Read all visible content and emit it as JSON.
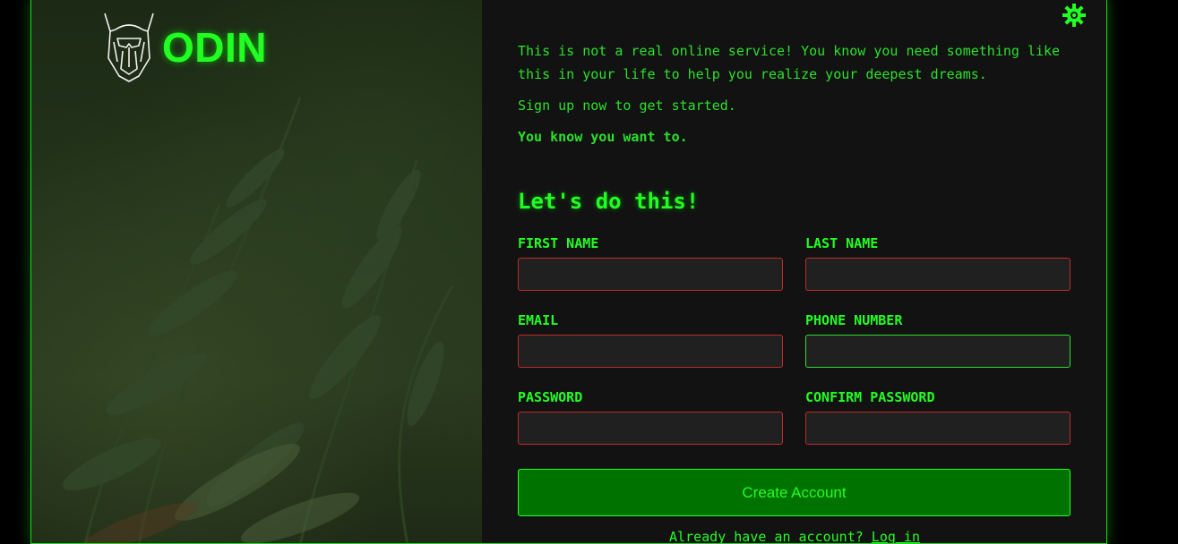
{
  "brand": {
    "name": "ODIN"
  },
  "intro": {
    "line1": "This is not a real online service! You know you need something like this in your life to help you realize your deepest dreams.",
    "line2": "Sign up now to get started.",
    "line3": "You know you want to."
  },
  "form": {
    "title": "Let's do this!",
    "fields": {
      "first_name": {
        "label": "FIRST NAME",
        "value": ""
      },
      "last_name": {
        "label": "LAST NAME",
        "value": ""
      },
      "email": {
        "label": "EMAIL",
        "value": ""
      },
      "phone": {
        "label": "PHONE NUMBER",
        "value": ""
      },
      "password": {
        "label": "PASSWORD",
        "value": ""
      },
      "confirm_password": {
        "label": "CONFIRM PASSWORD",
        "value": ""
      }
    },
    "submit_label": "Create Account",
    "login_prompt": "Already have an account?",
    "login_link": "Log in"
  },
  "icons": {
    "settings": "gear-icon",
    "logo": "viking-helmet-icon"
  },
  "colors": {
    "accent": "#22ff22",
    "error_border": "#c02a2a",
    "button_bg": "#007200",
    "panel_bg": "#121212"
  }
}
